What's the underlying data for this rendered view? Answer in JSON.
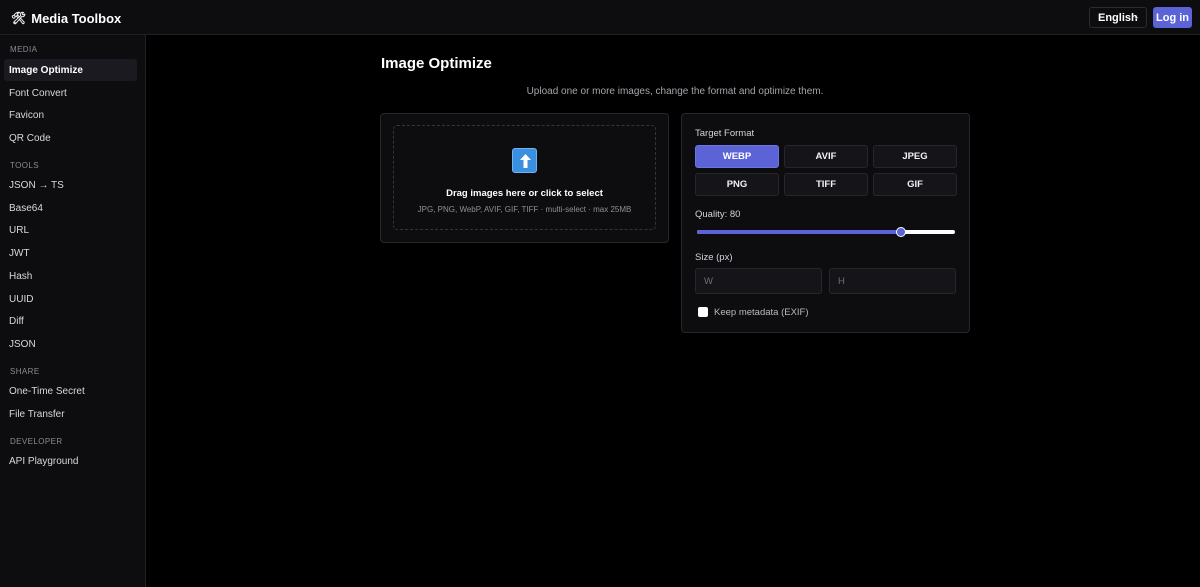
{
  "app": {
    "brand_icon": "🛠",
    "title": "Media Toolbox"
  },
  "header": {
    "language": "English",
    "login_label": "Log in"
  },
  "sidebar": {
    "sections": [
      {
        "label": "MEDIA",
        "items": [
          "Image Optimize",
          "Font Convert",
          "Favicon",
          "QR Code"
        ]
      },
      {
        "label": "TOOLS",
        "items": [
          "JSON → TS",
          "Base64",
          "URL",
          "JWT",
          "Hash",
          "UUID",
          "Diff",
          "JSON"
        ]
      },
      {
        "label": "SHARE",
        "items": [
          "One-Time Secret",
          "File Transfer"
        ]
      },
      {
        "label": "DEVELOPER",
        "items": [
          "API Playground"
        ]
      }
    ],
    "active_item": "Image Optimize"
  },
  "main": {
    "title": "Image Optimize",
    "subtitle": "Upload one or more images, change the format and optimize them.",
    "upload": {
      "icon": "upload-arrow-icon",
      "title": "Drag images here or click to select",
      "hint": "JPG, PNG, WebP, AVIF, GIF, TIFF · multi-select · max 25MB"
    },
    "settings": {
      "format_label": "Target Format",
      "formats": [
        "WEBP",
        "AVIF",
        "JPEG",
        "PNG",
        "TIFF",
        "GIF"
      ],
      "selected_format": "WEBP",
      "quality_label": "Quality: 80",
      "quality_value": 80,
      "quality_max": 100,
      "size_label": "Size (px)",
      "width_placeholder": "W",
      "height_placeholder": "H",
      "keep_metadata_label": "Keep metadata (EXIF)",
      "keep_metadata": false
    }
  },
  "colors": {
    "accent": "#5b63d6",
    "background": "#000000",
    "panel": "#0d0d10",
    "upload_icon": "#3b8fe0"
  }
}
